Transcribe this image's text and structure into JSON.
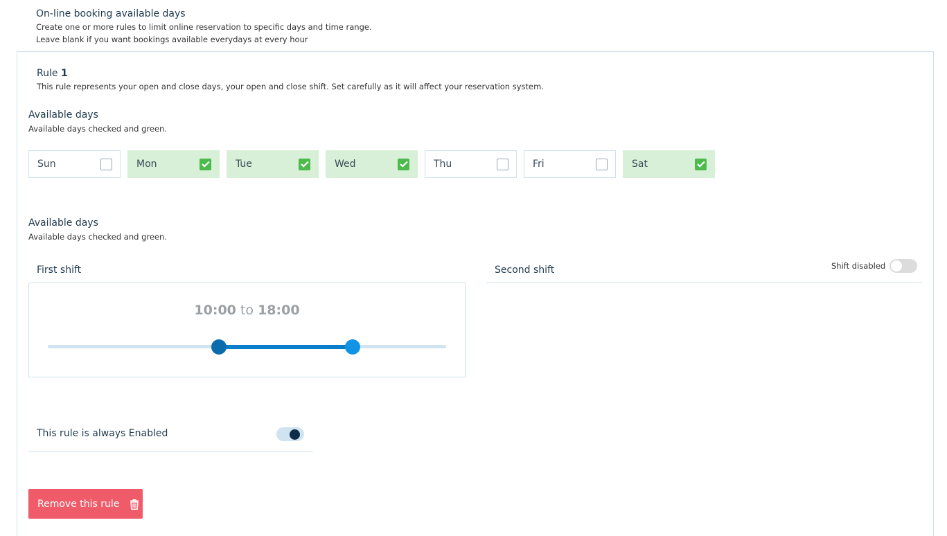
{
  "header": {
    "title": "On-line booking available days",
    "desc_line1": "Create one or more rules to limit online reservation to specific days and time range.",
    "desc_line2": "Leave blank if you want bookings available everydays at every hour"
  },
  "rule": {
    "title_prefix": "Rule",
    "number": "1",
    "description": "This rule represents your open and close days, your open and close shift. Set carefully as it will affect your reservation system."
  },
  "days_section": {
    "title": "Available days",
    "subtitle": "Available days checked and green."
  },
  "days": [
    {
      "label": "Sun",
      "checked": false
    },
    {
      "label": "Mon",
      "checked": true
    },
    {
      "label": "Tue",
      "checked": true
    },
    {
      "label": "Wed",
      "checked": true
    },
    {
      "label": "Thu",
      "checked": false
    },
    {
      "label": "Fri",
      "checked": false
    },
    {
      "label": "Sat",
      "checked": true
    }
  ],
  "shifts_section": {
    "title": "Available days",
    "subtitle": "Available days checked and green."
  },
  "first_shift": {
    "label": "First shift",
    "start": "10:00",
    "connector": "to",
    "end": "18:00",
    "start_fraction": 0.43,
    "end_fraction": 0.765
  },
  "second_shift": {
    "label": "Second shift",
    "toggle_label": "Shift disabled",
    "enabled": false
  },
  "always_enabled": {
    "label": "This rule is always Enabled",
    "enabled": true
  },
  "remove_button": {
    "label": "Remove this rule",
    "icon": "trash-icon"
  },
  "colors": {
    "checked_bg": "#d7f0d7",
    "check_green": "#4cbb4c",
    "slider_fill": "#0a7fc9",
    "remove_button": "#f05b6a"
  }
}
